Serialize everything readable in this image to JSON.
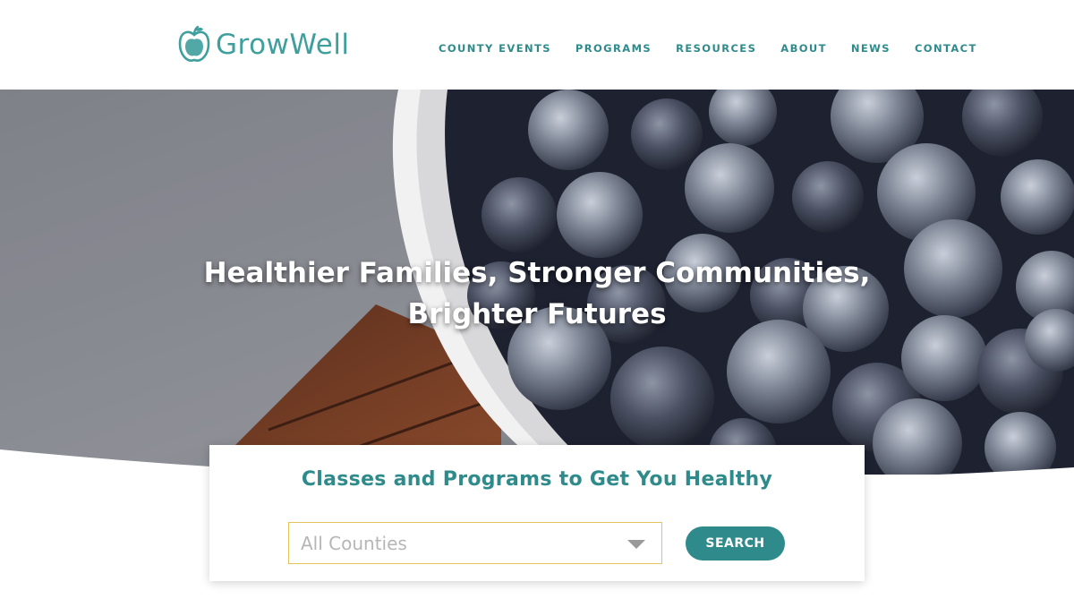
{
  "brand": {
    "name": "GrowWell",
    "logo_icon": "apple-icon",
    "color": "#3f9f9d"
  },
  "nav": {
    "items": [
      {
        "label": "COUNTY EVENTS"
      },
      {
        "label": "PROGRAMS"
      },
      {
        "label": "RESOURCES"
      },
      {
        "label": "ABOUT"
      },
      {
        "label": "NEWS"
      },
      {
        "label": "CONTACT"
      }
    ]
  },
  "hero": {
    "title_line1": "Healthier Families, Stronger Communities,",
    "title_line2": "Brighter Futures",
    "image_subject": "bowl of frozen blueberries"
  },
  "search_card": {
    "title": "Classes and Programs to Get You Healthy",
    "county_select": {
      "selected": "All Counties"
    },
    "search_label": "SEARCH"
  },
  "colors": {
    "accent": "#2f8b8b",
    "select_border": "#e2c35e"
  }
}
